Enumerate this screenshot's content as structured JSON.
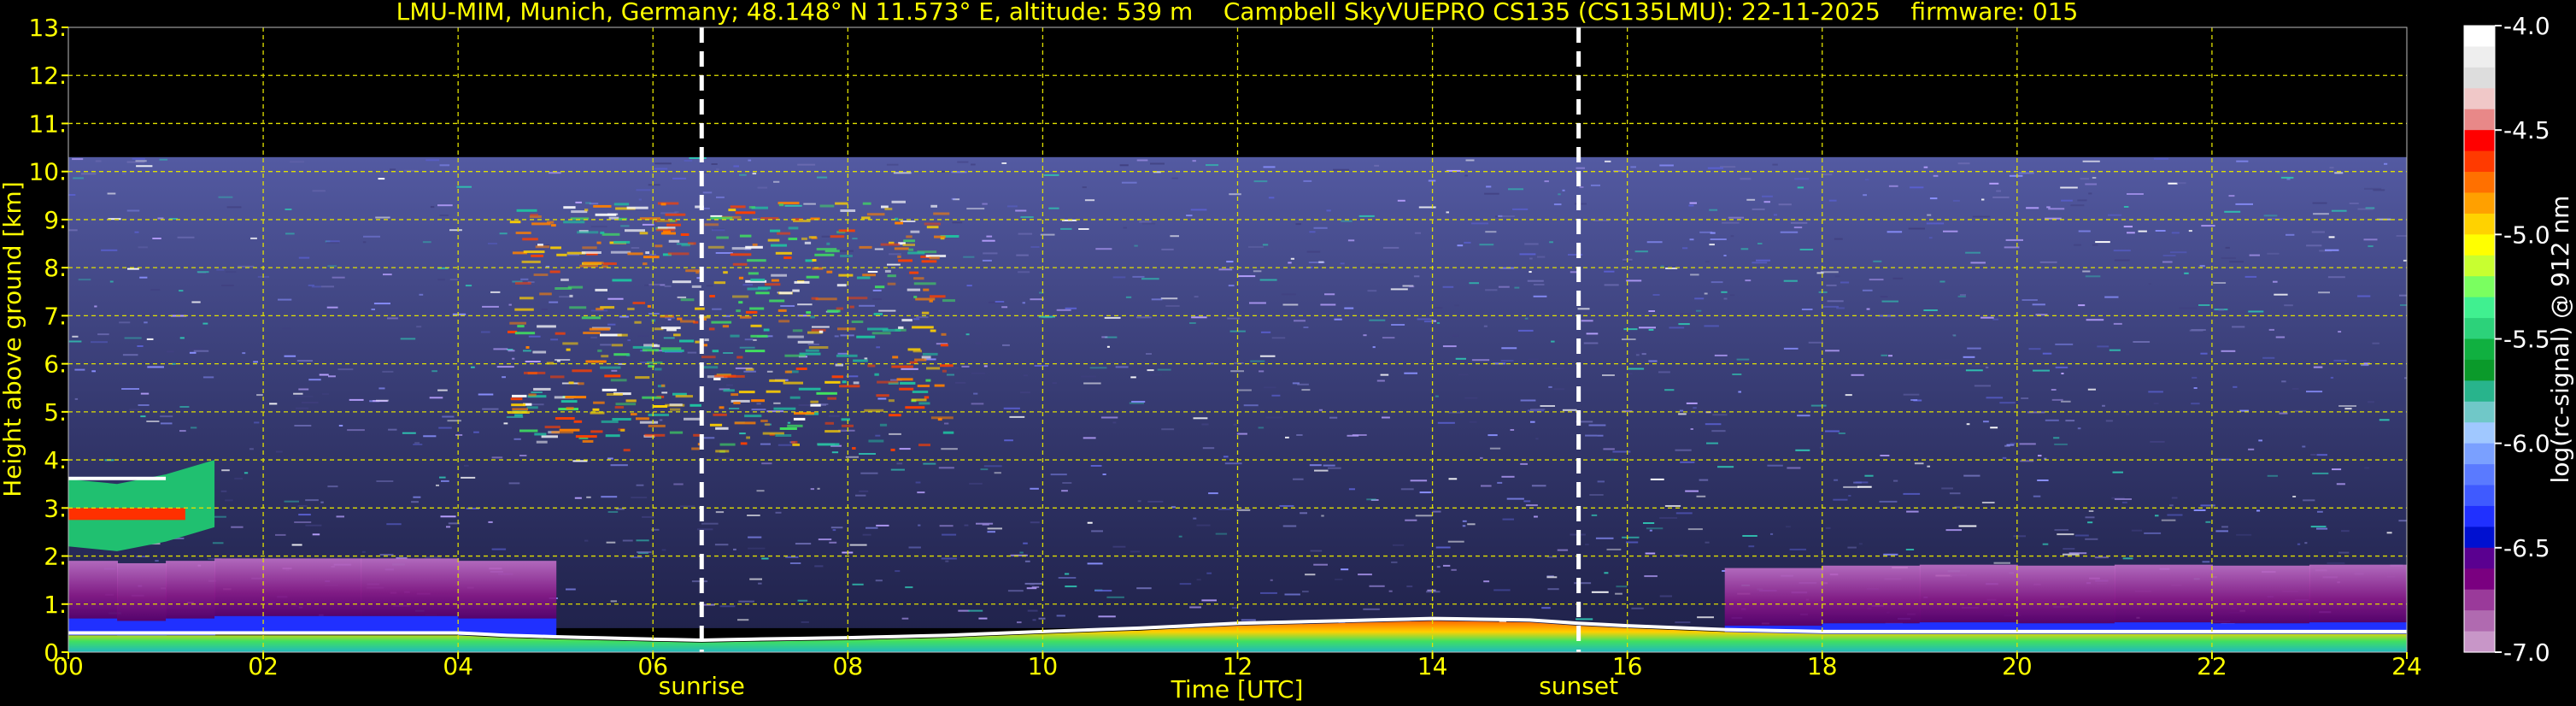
{
  "chart_data": {
    "type": "heatmap",
    "title": "LMU-MIM, Munich, Germany; 48.148° N 11.573° E, altitude: 539 m    Campbell SkyVUEPRO CS135 (CS135LMU): 22-11-2025    firmware: 015",
    "xlabel": "Time [UTC]",
    "ylabel": "Height above ground [km]",
    "xlim": [
      0,
      24
    ],
    "ylim": [
      0,
      13
    ],
    "x_ticks": [
      "00",
      "02",
      "04",
      "06",
      "08",
      "10",
      "12",
      "14",
      "16",
      "18",
      "20",
      "22",
      "24"
    ],
    "y_ticks": [
      "0.",
      "1.",
      "2.",
      "3.",
      "4.",
      "5.",
      "6.",
      "7.",
      "8.",
      "9.",
      "10.",
      "11.",
      "12.",
      "13."
    ],
    "grid": true,
    "markers": [
      {
        "label": "sunrise",
        "x": 6.5
      },
      {
        "label": "sunset",
        "x": 15.5
      }
    ],
    "colorbar": {
      "label": "log(rc-signal) @ 912 nm",
      "range": [
        -7.0,
        -4.0
      ],
      "ticks": [
        "-4.0",
        "-4.5",
        "-5.0",
        "-5.5",
        "-6.0",
        "-6.5",
        "-7.0"
      ],
      "colors": [
        "#ffffff",
        "#eeeeee",
        "#dddddd",
        "#f0c8c8",
        "#e88888",
        "#ff0000",
        "#ff3a00",
        "#ff7000",
        "#ffa000",
        "#ffd200",
        "#ffff00",
        "#c8ff30",
        "#7aff60",
        "#40f090",
        "#2cd27a",
        "#10b040",
        "#0a9a2a",
        "#28b48c",
        "#70c8c8",
        "#a0c8ff",
        "#7aa0ff",
        "#5a7aff",
        "#3f5aff",
        "#2030ff",
        "#0010d0",
        "#5a0090",
        "#7a0080",
        "#9a3a9a",
        "#b06ab0",
        "#c896c8"
      ]
    },
    "signal_top_km": 10.3,
    "series": [
      {
        "x": [
          0,
          1,
          2,
          3,
          4,
          4.5,
          5,
          6,
          6.5,
          7,
          8,
          9,
          10,
          11,
          12,
          13,
          14,
          15,
          15.5,
          16,
          17,
          18,
          20,
          22,
          24
        ],
        "values": [
          0.35,
          0.35,
          0.35,
          0.35,
          0.35,
          0.3,
          0.27,
          0.22,
          0.2,
          0.22,
          0.25,
          0.3,
          0.38,
          0.45,
          0.55,
          0.6,
          0.65,
          0.62,
          0.55,
          0.5,
          0.42,
          0.38,
          0.38,
          0.38,
          0.38
        ]
      },
      {
        "x": [
          0,
          0.5,
          1,
          1.5,
          2,
          3,
          4,
          5,
          6,
          7,
          8,
          9,
          10,
          11,
          12,
          13,
          14,
          15,
          15.5,
          16,
          17,
          18,
          19,
          20,
          21,
          22,
          23,
          24
        ],
        "values": [
          0.7,
          0.65,
          0.7,
          0.75,
          0.75,
          0.75,
          0.7,
          0,
          0,
          0,
          0,
          0,
          0,
          0,
          0,
          0,
          0,
          0,
          0,
          0,
          0.55,
          0.6,
          0.62,
          0.6,
          0.62,
          0.6,
          0.62,
          0.6
        ]
      },
      {
        "x": [
          0,
          0.5,
          1,
          1.5
        ],
        "values": [
          2.2,
          2.1,
          2.3,
          2.6
        ]
      }
    ]
  }
}
